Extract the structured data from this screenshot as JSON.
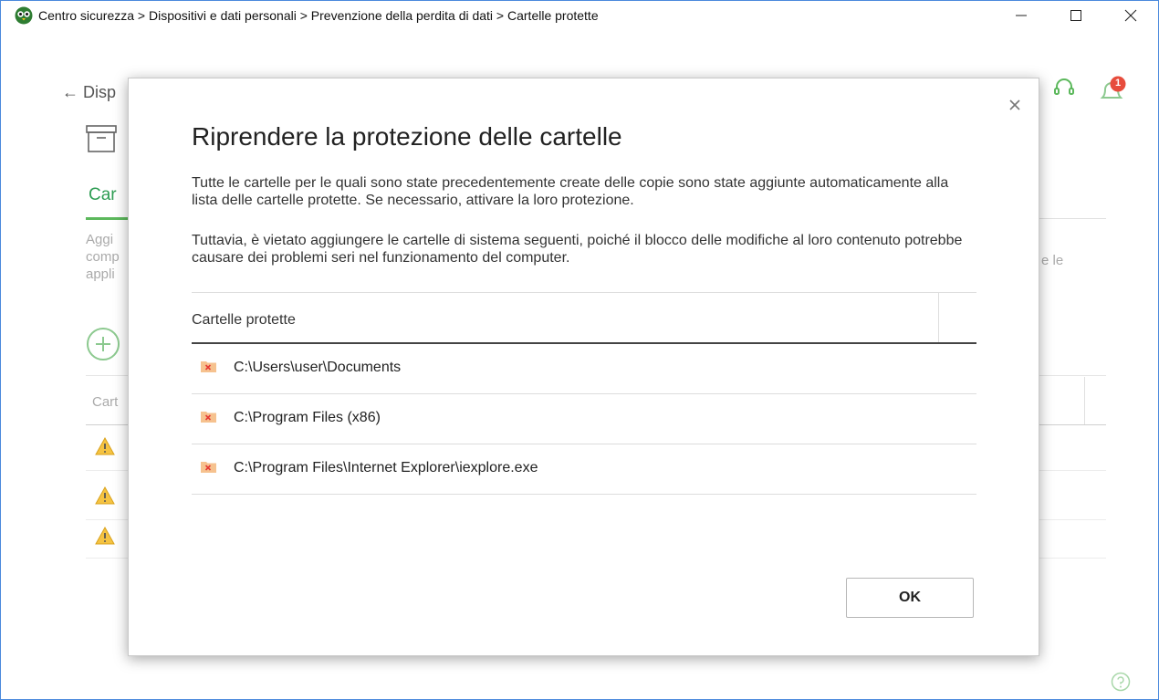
{
  "window": {
    "title": "Centro sicurezza > Dispositivi e dati personali > Prevenzione della perdita di dati > Cartelle protette"
  },
  "background": {
    "back_link": "← Disp",
    "tab_label": "Car",
    "description_lines": [
      "Aggi",
      "comp",
      "appli"
    ],
    "description_right": "e le",
    "column_header": "Cart",
    "warning_rows": 3,
    "notification_count": "1",
    "colors": {
      "accent_green": "#5cb85c",
      "warning_yellow": "#f5c342",
      "badge_red": "#e74c3c"
    }
  },
  "dialog": {
    "title": "Riprendere la protezione delle cartelle",
    "paragraph1": "Tutte le cartelle per le quali sono state precedentemente create delle copie sono state aggiunte automaticamente alla lista delle cartelle protette. Se necessario, attivare la loro protezione.",
    "paragraph2": "Tuttavia, è vietato aggiungere le cartelle di sistema seguenti, poiché il blocco delle modifiche al loro contenuto potrebbe causare dei problemi seri nel funzionamento del computer.",
    "table": {
      "column_header": "Cartelle protette",
      "rows": [
        {
          "path": "C:\\Users\\user\\Documents",
          "icon": "folder-blocked-icon"
        },
        {
          "path": "C:\\Program Files (x86)",
          "icon": "folder-blocked-icon"
        },
        {
          "path": "C:\\Program Files\\Internet Explorer\\iexplore.exe",
          "icon": "folder-blocked-icon"
        }
      ]
    },
    "ok_label": "OK"
  }
}
